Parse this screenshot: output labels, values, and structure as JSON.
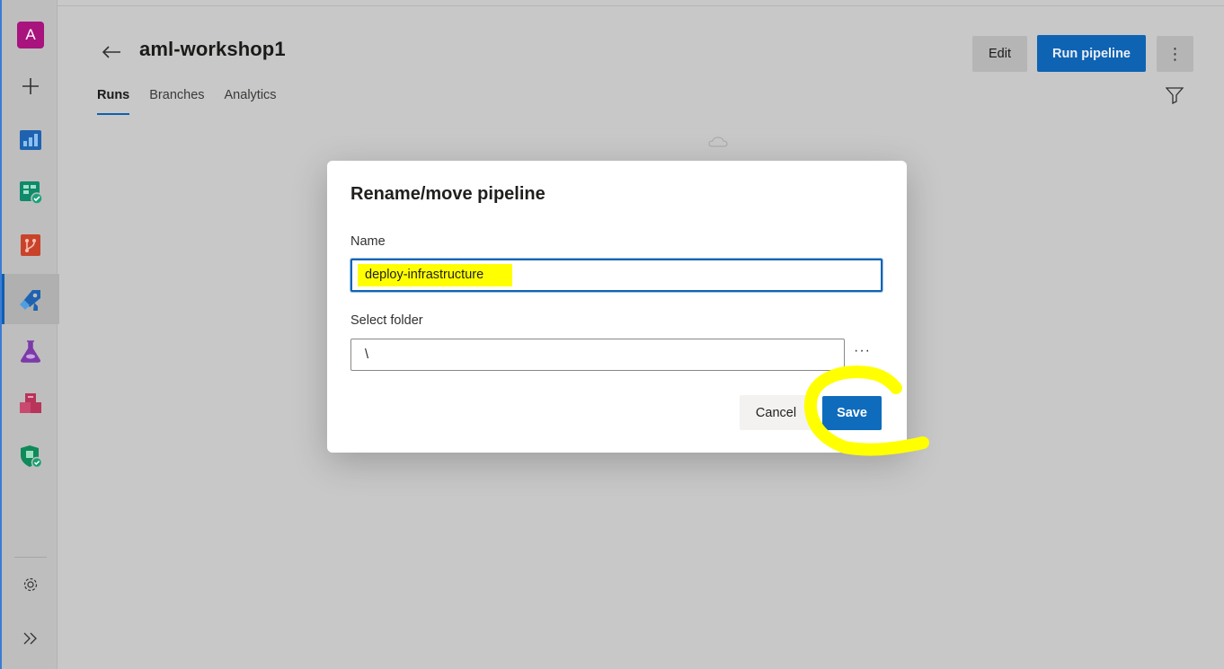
{
  "rail": {
    "avatar_initial": "A",
    "items": [
      "add-icon",
      "overview-icon",
      "boards-icon",
      "repos-icon",
      "pipelines-icon",
      "test-plans-icon",
      "artifacts-icon",
      "security-icon",
      "settings-icon",
      "expand-icon"
    ],
    "active": "pipelines-icon"
  },
  "header": {
    "title": "aml-workshop1",
    "tabs": [
      {
        "label": "Runs",
        "active": true
      },
      {
        "label": "Branches",
        "active": false
      },
      {
        "label": "Analytics",
        "active": false
      }
    ],
    "edit_label": "Edit",
    "run_label": "Run pipeline",
    "more_label": "⋮"
  },
  "dialog": {
    "title": "Rename/move pipeline",
    "name_label": "Name",
    "name_value": "deploy-infrastructure",
    "folder_label": "Select folder",
    "folder_value": "\\",
    "browse_label": "···",
    "cancel_label": "Cancel",
    "save_label": "Save"
  },
  "colors": {
    "accent": "#0f6cbd",
    "highlight": "#ffff00",
    "overlay": "#c8c8c8"
  }
}
